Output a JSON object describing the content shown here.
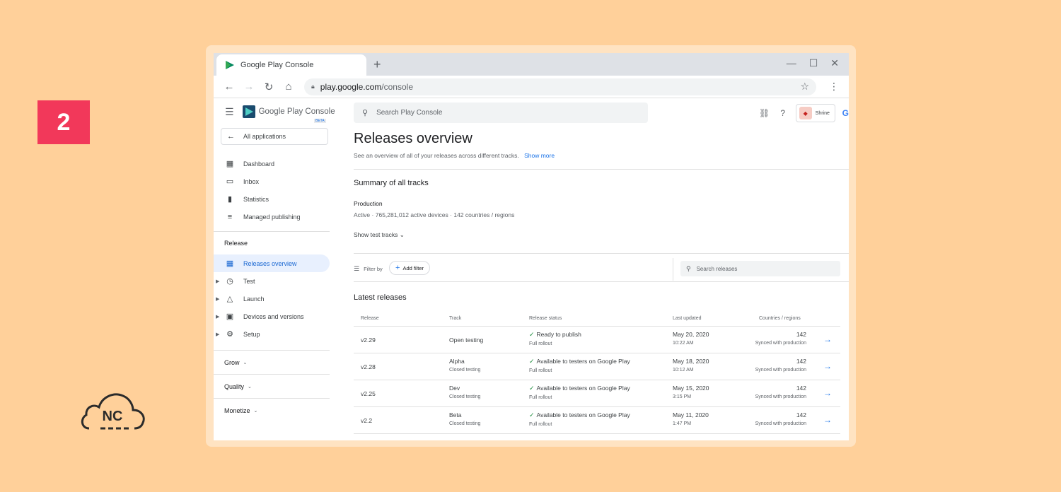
{
  "step_number": "2",
  "logo_text": "NC",
  "browser": {
    "tab_title": "Google Play Console",
    "new_tab": "+",
    "url_host": "play.google.com",
    "url_path": "/console"
  },
  "sidebar": {
    "brand": "Google Play Console",
    "beta": "BETA",
    "back_label": "All applications",
    "items": [
      {
        "label": "Dashboard",
        "icon": "dashboard-icon"
      },
      {
        "label": "Inbox",
        "icon": "inbox-icon"
      },
      {
        "label": "Statistics",
        "icon": "statistics-icon"
      },
      {
        "label": "Managed publishing",
        "icon": "managed-publishing-icon"
      }
    ],
    "release_section": "Release",
    "release_items": [
      {
        "label": "Releases overview",
        "icon": "releases-overview-icon",
        "active": true
      },
      {
        "label": "Test",
        "icon": "test-icon"
      },
      {
        "label": "Launch",
        "icon": "launch-icon"
      },
      {
        "label": "Devices and versions",
        "icon": "devices-icon"
      },
      {
        "label": "Setup",
        "icon": "setup-icon"
      }
    ],
    "groups": [
      "Grow",
      "Quality",
      "Monetize"
    ]
  },
  "header": {
    "search_placeholder": "Search Play Console",
    "account_name": "Shrine"
  },
  "main": {
    "title": "Releases overview",
    "subtitle": "See an overview of all of your releases across different tracks.",
    "show_more": "Show more",
    "summary_title": "Summary of all tracks",
    "production_label": "Production",
    "production_status": "Active",
    "production_devices": "765,281,012 active devices",
    "production_countries": "142 countries / regions",
    "show_test_tracks": "Show test tracks",
    "filter_by": "Filter by",
    "add_filter": "Add filter",
    "search_releases": "Search releases",
    "latest_title": "Latest releases",
    "columns": [
      "Release",
      "Track",
      "Release status",
      "Last updated",
      "Countries / regions"
    ],
    "rows": [
      {
        "release": "v2.29",
        "track": "Open testing",
        "track_sub": "",
        "status": "Ready to publish",
        "status_sub": "Full rollout",
        "date": "May 20, 2020",
        "time": "10:22 AM",
        "count": "142",
        "count_sub": "Synced with production"
      },
      {
        "release": "v2.28",
        "track": "Alpha",
        "track_sub": "Closed testing",
        "status": "Available to testers on Google Play",
        "status_sub": "Full rollout",
        "date": "May 18, 2020",
        "time": "10:12 AM",
        "count": "142",
        "count_sub": "Synced with production"
      },
      {
        "release": "v2.25",
        "track": "Dev",
        "track_sub": "Closed testing",
        "status": "Available to testers on Google Play",
        "status_sub": "Full rollout",
        "date": "May 15, 2020",
        "time": "3:15 PM",
        "count": "142",
        "count_sub": "Synced with production"
      },
      {
        "release": "v2.2",
        "track": "Beta",
        "track_sub": "Closed testing",
        "status": "Available to testers on Google Play",
        "status_sub": "Full rollout",
        "date": "May 11, 2020",
        "time": "1:47 PM",
        "count": "142",
        "count_sub": "Synced with production"
      }
    ]
  }
}
